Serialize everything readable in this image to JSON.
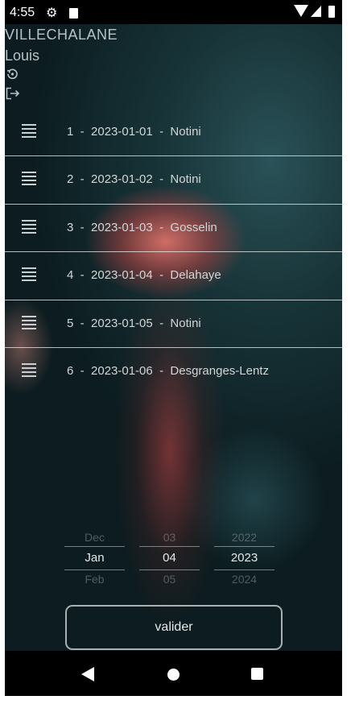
{
  "status_bar": {
    "time": "4:55",
    "icons": [
      "gear-icon",
      "sd-card-icon",
      "wifi-icon",
      "signal-icon",
      "battery-icon"
    ]
  },
  "header": {
    "title": "VILLECHALANE",
    "user": "Louis",
    "icons": [
      "restore-icon",
      "logout-icon"
    ]
  },
  "rows": [
    {
      "text": "1  -  2023-01-01  -  Notini"
    },
    {
      "text": "2  -  2023-01-02  -  Notini"
    },
    {
      "text": "3  -  2023-01-03  -  Gosselin"
    },
    {
      "text": "4  -  2023-01-04  -  Delahaye"
    },
    {
      "text": "5  -  2023-01-05  -  Notini"
    },
    {
      "text": "6  -  2023-01-06  -  Desgranges-Lentz"
    }
  ],
  "date_picker": {
    "month": {
      "prev": "Dec",
      "current": "Jan",
      "next": "Feb"
    },
    "day": {
      "prev": "03",
      "current": "04",
      "next": "05"
    },
    "year": {
      "prev": "2022",
      "current": "2023",
      "next": "2024"
    }
  },
  "valider_label": "valider",
  "nav_bar": {
    "icons": [
      "back-icon",
      "home-icon",
      "recents-icon"
    ]
  },
  "colors": {
    "accent_text": "#b7c2c4",
    "background": "#122a2e"
  }
}
